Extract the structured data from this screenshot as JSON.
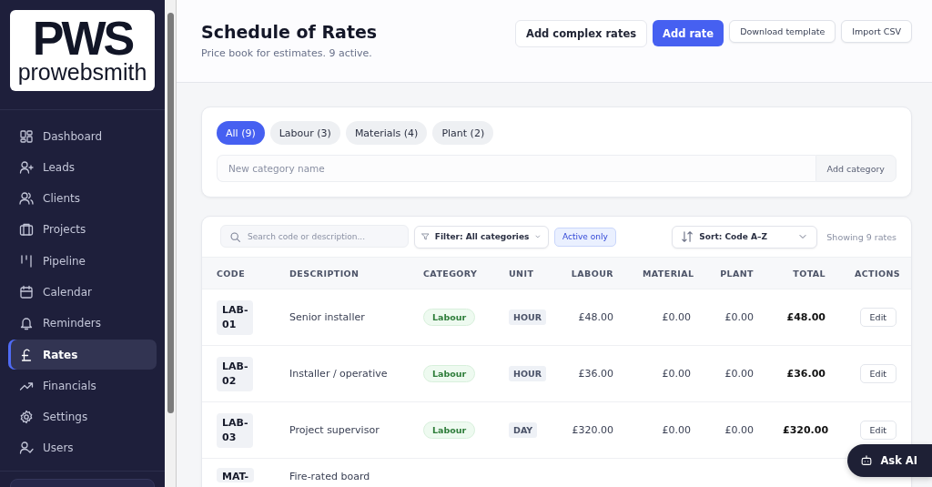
{
  "logo": {
    "mark": "PWS",
    "wordmark": "prowebsmith"
  },
  "sidebar": {
    "items": [
      {
        "label": "Dashboard",
        "selected": false
      },
      {
        "label": "Leads",
        "selected": false
      },
      {
        "label": "Clients",
        "selected": false
      },
      {
        "label": "Projects",
        "selected": false
      },
      {
        "label": "Pipeline",
        "selected": false
      },
      {
        "label": "Calendar",
        "selected": false
      },
      {
        "label": "Reminders",
        "selected": false
      },
      {
        "label": "Rates",
        "selected": true
      },
      {
        "label": "Financials",
        "selected": false
      },
      {
        "label": "Settings",
        "selected": false
      },
      {
        "label": "Users",
        "selected": false
      }
    ]
  },
  "header": {
    "title": "Schedule of Rates",
    "subtitle": "Price book for estimates. 9 active.",
    "buttons": [
      {
        "label": "Add complex rates",
        "kind": "secondary"
      },
      {
        "label": "Add rate",
        "kind": "primary"
      },
      {
        "label": "Download template",
        "kind": "small"
      },
      {
        "label": "Import CSV",
        "kind": "small"
      }
    ]
  },
  "categories": {
    "tabs": [
      {
        "label": "All (9)",
        "selected": true
      },
      {
        "label": "Labour (3)",
        "selected": false
      },
      {
        "label": "Materials (4)",
        "selected": false
      },
      {
        "label": "Plant (2)",
        "selected": false
      }
    ],
    "new_category": {
      "placeholder": "New category name",
      "button": "Add category"
    }
  },
  "toolbar": {
    "search": {
      "placeholder": "Search code or description..."
    },
    "filter": "Filter: All categories",
    "active_only": {
      "label": "Active only",
      "on": true
    },
    "sort": "Sort: Code A–Z",
    "count": "Showing 9 rates"
  },
  "table": {
    "columns": [
      "CODE",
      "DESCRIPTION",
      "CATEGORY",
      "UNIT",
      "LABOUR",
      "MATERIAL",
      "PLANT",
      "TOTAL",
      "ACTIONS"
    ],
    "rows": [
      {
        "code": "LAB-\n01",
        "description": "Senior installer",
        "category": "Labour",
        "unit": "HOUR",
        "labour": "£48.00",
        "material": "£0.00",
        "plant": "£0.00",
        "total": "£48.00",
        "action": "Edit"
      },
      {
        "code": "LAB-\n02",
        "description": "Installer / operative",
        "category": "Labour",
        "unit": "HOUR",
        "labour": "£36.00",
        "material": "£0.00",
        "plant": "£0.00",
        "total": "£36.00",
        "action": "Edit"
      },
      {
        "code": "LAB-\n03",
        "description": "Project supervisor",
        "category": "Labour",
        "unit": "DAY",
        "labour": "£320.00",
        "material": "£0.00",
        "plant": "£0.00",
        "total": "£320.00",
        "action": "Edit"
      },
      {
        "code": "MAT-",
        "description": "Fire-rated board"
      }
    ]
  },
  "assistant": {
    "label": "Ask AI"
  }
}
